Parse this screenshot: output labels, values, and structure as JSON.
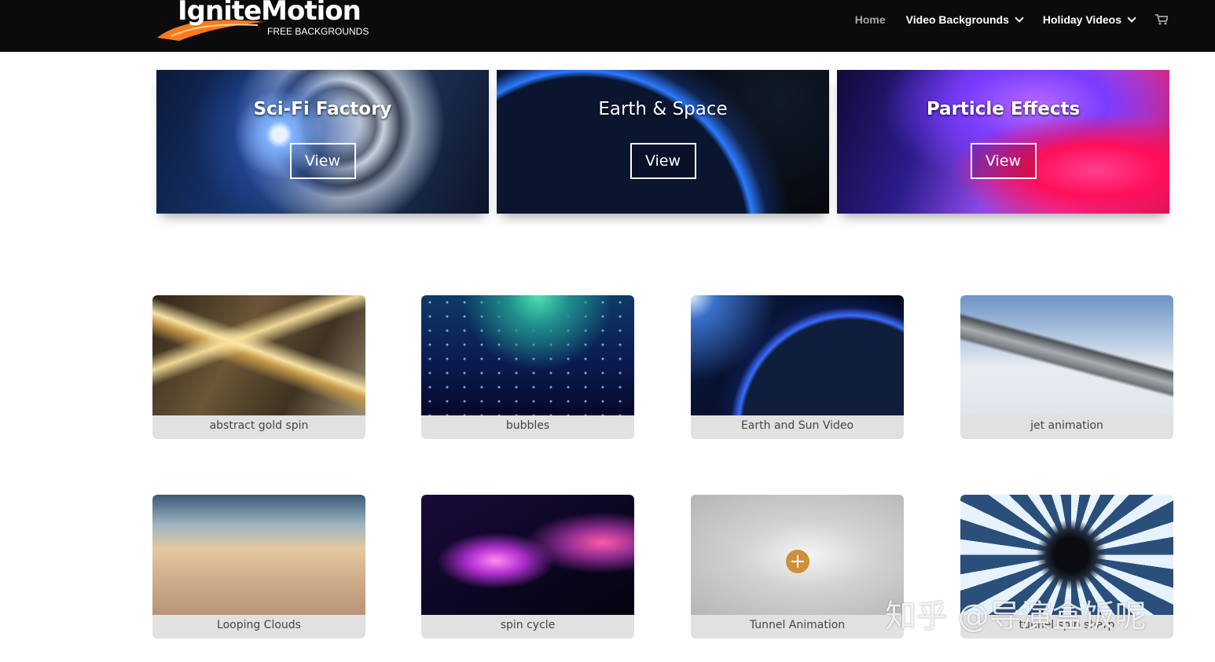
{
  "header": {
    "logo": {
      "title": "IgniteMotion",
      "subtitle": "FREE BACKGROUNDS"
    },
    "nav": [
      {
        "label": "Home",
        "active": true
      },
      {
        "label": "Video Backgrounds",
        "has_dropdown": true
      },
      {
        "label": "Holiday Videos",
        "has_dropdown": true
      }
    ],
    "cart_icon": "cart-icon"
  },
  "banners": [
    {
      "title": "Sci-Fi Factory",
      "button": "View"
    },
    {
      "title": "Earth & Space",
      "button": "View"
    },
    {
      "title": "Particle Effects",
      "button": "View"
    }
  ],
  "videos": [
    {
      "title": "abstract gold spin"
    },
    {
      "title": "bubbles"
    },
    {
      "title": "Earth and Sun Video"
    },
    {
      "title": "jet animation"
    },
    {
      "title": "Looping Clouds"
    },
    {
      "title": "spin cycle"
    },
    {
      "title": "Tunnel Animation",
      "hover": true
    },
    {
      "title": "tunnel spin sharp"
    }
  ],
  "watermark": "知乎 @导演盒饭呢",
  "colors": {
    "header_bg": "#0b0b0b",
    "accent": "#cc8f3b",
    "caption_bg": "#e1e1e1"
  }
}
